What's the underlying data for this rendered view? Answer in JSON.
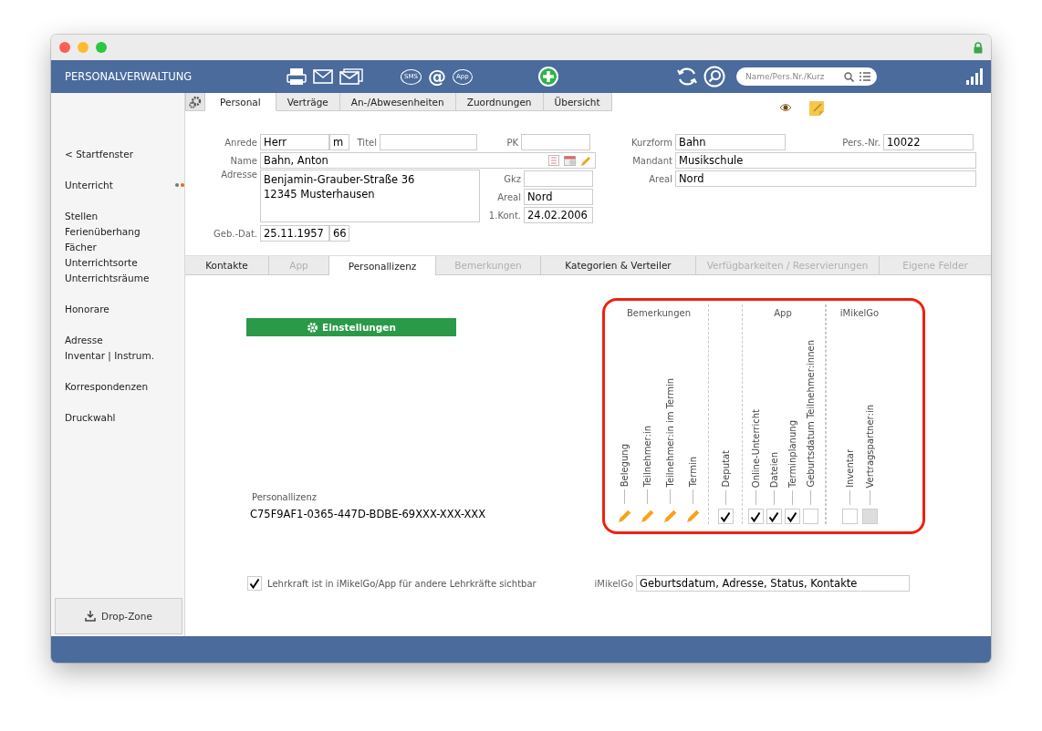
{
  "header": {
    "title": "PERSONALVERWALTUNG",
    "sms_label": "SMS",
    "at_label": "@",
    "app_label": "App",
    "search": {
      "placeholder": "Name/Pers.Nr./Kurz"
    }
  },
  "sidebar": {
    "groups": [
      [
        {
          "label": "< Startfenster",
          "dots": false
        }
      ],
      [
        {
          "label": "Unterricht",
          "dots": true
        }
      ],
      [
        {
          "label": "Stellen",
          "dots": false
        },
        {
          "label": "Ferienüberhang",
          "dots": false
        },
        {
          "label": "Fächer",
          "dots": false
        },
        {
          "label": "Unterrichtsorte",
          "dots": false
        },
        {
          "label": "Unterrichtsräume",
          "dots": false
        }
      ],
      [
        {
          "label": "Honorare",
          "dots": false
        }
      ],
      [
        {
          "label": "Adresse",
          "dots": false
        },
        {
          "label": "Inventar | Instrum.",
          "dots": false
        }
      ],
      [
        {
          "label": "Korrespondenzen",
          "dots": false
        }
      ],
      [
        {
          "label": "Druckwahl",
          "dots": false
        }
      ]
    ],
    "drop_zone": "Drop-Zone"
  },
  "tabs": [
    {
      "label": "Personal",
      "selected": true
    },
    {
      "label": "Verträge",
      "selected": false
    },
    {
      "label": "An-/Abwesenheiten",
      "selected": false
    },
    {
      "label": "Zuordnungen",
      "selected": false
    },
    {
      "label": "Übersicht",
      "selected": false
    }
  ],
  "form": {
    "anrede_label": "Anrede",
    "anrede": "Herr",
    "geschlecht": "m",
    "titel_label": "Titel",
    "pk_label": "PK",
    "name_label": "Name",
    "name": "Bahn, Anton",
    "adresse_label": "Adresse",
    "adresse": [
      "Benjamin-Grauber-Straße 36",
      "12345 Musterhausen"
    ],
    "gkz_label": "Gkz",
    "areal_label": "Areal",
    "areal": "Nord",
    "kont_label": "1.Kont.",
    "kont": "24.02.2006",
    "geb_label": "Geb.-Dat.",
    "geb": "25.11.1957",
    "alter": "66",
    "kurzform_label": "Kurzform",
    "kurzform": "Bahn",
    "persnr_label": "Pers.-Nr.",
    "persnr": "10022",
    "mandant_label": "Mandant",
    "mandant": "Musikschule",
    "areal2_label": "Areal",
    "areal2": "Nord"
  },
  "subtabs": [
    {
      "label": "Kontakte",
      "selected": false,
      "disabled": false
    },
    {
      "label": "App",
      "selected": false,
      "disabled": true
    },
    {
      "label": "Personallizenz",
      "selected": true,
      "disabled": false
    },
    {
      "label": "Bemerkungen",
      "selected": false,
      "disabled": true
    },
    {
      "label": "Kategorien & Verteiler",
      "selected": false,
      "disabled": false
    },
    {
      "label": "Verfügbarkeiten / Reservierungen",
      "selected": false,
      "disabled": true
    },
    {
      "label": "Eigene Felder",
      "selected": false,
      "disabled": true
    }
  ],
  "license": {
    "settings_button": "Einstellungen",
    "label": "Personallizenz",
    "code": "C75F9AF1-0365-447D-BDBE-69XXX-XXX-XXX"
  },
  "permissions": [
    {
      "title": "Bemerkungen",
      "items": [
        {
          "label": "Belegung",
          "kind": "pencil"
        },
        {
          "label": "Teilnehmer:in",
          "kind": "pencil"
        },
        {
          "label": "Teilnehmer:in im Termin",
          "kind": "pencil"
        },
        {
          "label": "Termin",
          "kind": "pencil"
        }
      ]
    },
    {
      "items": [
        {
          "label": "Deputat",
          "kind": "checkbox",
          "checked": true,
          "disabled": false
        }
      ]
    },
    {
      "title": "App",
      "items": [
        {
          "label": "Online-Unterricht",
          "kind": "checkbox",
          "checked": true,
          "disabled": false
        },
        {
          "label": "Dateien",
          "kind": "checkbox",
          "checked": true,
          "disabled": false
        },
        {
          "label": "Terminplanung",
          "kind": "checkbox",
          "checked": true,
          "disabled": false
        },
        {
          "label": "Geburtsdatum Teilnehmer:innen",
          "kind": "checkbox",
          "checked": false,
          "disabled": false
        }
      ]
    },
    {
      "title": "iMikelGo",
      "items": [
        {
          "label": "Inventar",
          "kind": "checkbox",
          "checked": false,
          "disabled": false
        },
        {
          "label": "Vertragspartner:in",
          "kind": "checkbox",
          "checked": false,
          "disabled": true
        }
      ]
    }
  ],
  "visibility": {
    "label": "Lehrkraft ist in iMikelGo/App für andere Lehrkräfte sichtbar",
    "checked": true,
    "imikelgo_label": "iMikelGo",
    "imikelgo_value": "Geburtsdatum, Adresse, Status, Kontakte"
  }
}
